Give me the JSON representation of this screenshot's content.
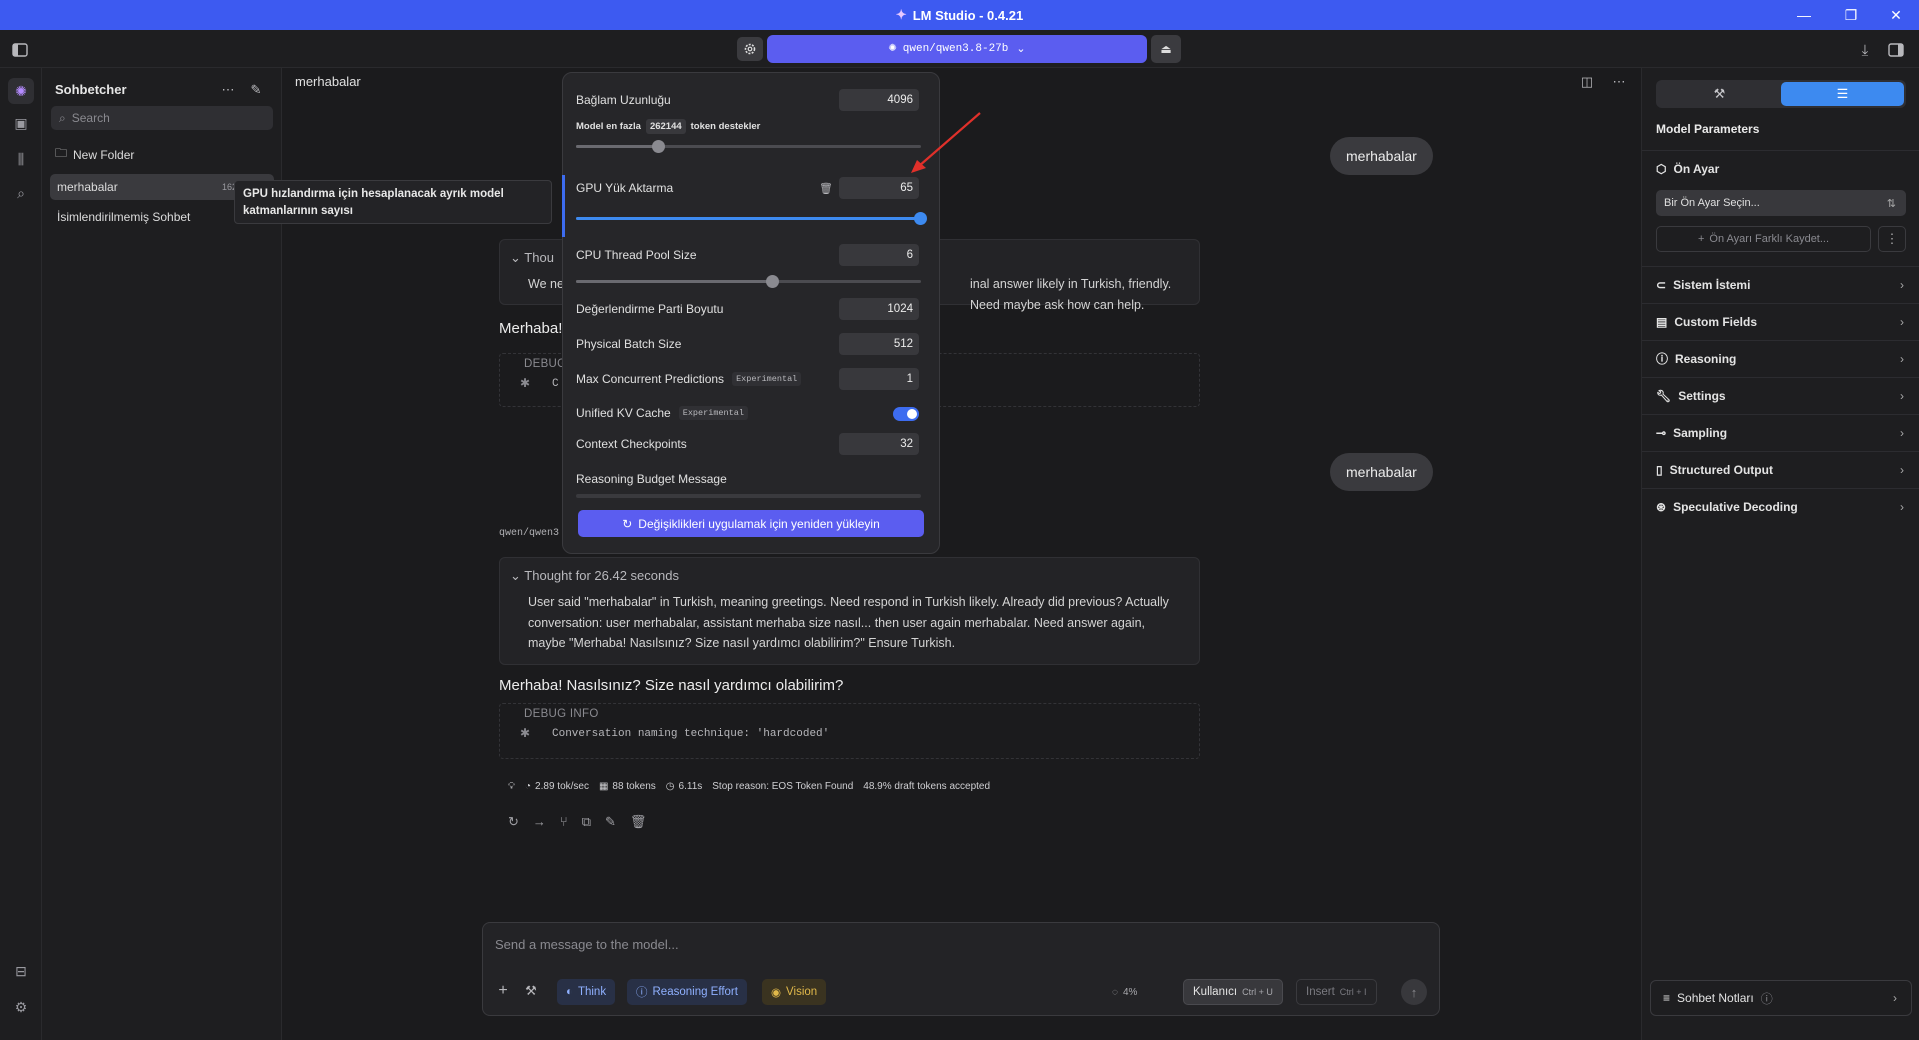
{
  "window": {
    "title": "LM Studio - 0.4.21"
  },
  "topbar": {
    "model": "qwen/qwen3.8-27b"
  },
  "sidebar": {
    "title": "Sohbetcher",
    "search_placeholder": "Search",
    "new_folder": "New Folder",
    "chats": [
      {
        "name": "merhabalar",
        "tokens": "162 tokens"
      },
      {
        "name": "İsimlendirilmemiş Sohbet"
      }
    ]
  },
  "tooltip": {
    "text": "GPU hızlandırma için hesaplanacak ayrık model katmanlarının sayısı"
  },
  "chat": {
    "title": "merhabalar",
    "user_msg_1": "merhabalar",
    "user_msg_2": "merhabalar",
    "thought1_head": "Thou",
    "thought1_body_left": "We ne",
    "thought1_body_right": "inal answer likely in Turkish, friendly. Need maybe ask how can help.",
    "answer1": "Merhaba!",
    "debug1_head": "DEBUG",
    "debug1_code": "C",
    "model_label": "qwen/qwen3",
    "thought2_head": "Thought for 26.42 seconds",
    "thought2_body": "User said \"merhabalar\" in Turkish, meaning greetings. Need respond in Turkish likely. Already did previous? Actually conversation: user merhabalar, assistant merhaba size nasıl... then user again merhabalar. Need answer again, maybe \"Merhaba! Nasılsınız? Size nasıl yardımcı olabilirim?\" Ensure Turkish.",
    "answer2": "Merhaba! Nasılsınız? Size nasıl yardımcı olabilirim?",
    "debug2_head": "DEBUG INFO",
    "debug2_code": "Conversation naming technique: 'hardcoded'",
    "stats": {
      "speed": "2.89 tok/sec",
      "tokens": "88 tokens",
      "time": "6.11s",
      "stop": "Stop reason: EOS Token Found",
      "draft": "48.9% draft tokens accepted"
    }
  },
  "composer": {
    "placeholder": "Send a message to the model...",
    "think": "Think",
    "reasoning": "Reasoning Effort",
    "vision": "Vision",
    "ctx_pct": "4%",
    "user_role": "Kullanıcı",
    "user_shortcut": "Ctrl + U",
    "insert": "Insert",
    "insert_shortcut": "Ctrl + I"
  },
  "load_popup": {
    "context_label": "Bağlam Uzunluğu",
    "context_value": "4096",
    "context_note_pre": "Model en fazla",
    "context_max": "262144",
    "context_note_post": "token destekler",
    "context_slider": 0.24,
    "gpu_label": "GPU Yük Aktarma",
    "gpu_value": "65",
    "gpu_slider": 1.0,
    "cpu_label": "CPU Thread Pool Size",
    "cpu_value": "6",
    "cpu_slider": 0.57,
    "eval_batch_label": "Değerlendirme Parti Boyutu",
    "eval_batch_value": "1024",
    "phys_batch_label": "Physical Batch Size",
    "phys_batch_value": "512",
    "max_conc_label": "Max Concurrent Predictions",
    "max_conc_badge": "Experimental",
    "max_conc_value": "1",
    "kv_label": "Unified KV Cache",
    "kv_badge": "Experimental",
    "kv_enabled": true,
    "ckpt_label": "Context Checkpoints",
    "ckpt_value": "32",
    "budget_label": "Reasoning Budget Message",
    "reload_button": "Değişiklikleri uygulamak için yeniden yükleyin"
  },
  "right_panel": {
    "title": "Model Parameters",
    "preset_heading": "Ön Ayar",
    "preset_select": "Bir Ön Ayar Seçin...",
    "preset_save": "Ön Ayarı Farklı Kaydet...",
    "sections": [
      "Sistem İstemi",
      "Custom Fields",
      "Reasoning",
      "Settings",
      "Sampling",
      "Structured Output",
      "Speculative Decoding"
    ],
    "notes": "Sohbet Notları"
  },
  "colors": {
    "accent": "#5b5df0",
    "titlebar": "#3d5af1",
    "toggle": "#3d6cf0",
    "gpu_slider": "#3d8af0"
  }
}
